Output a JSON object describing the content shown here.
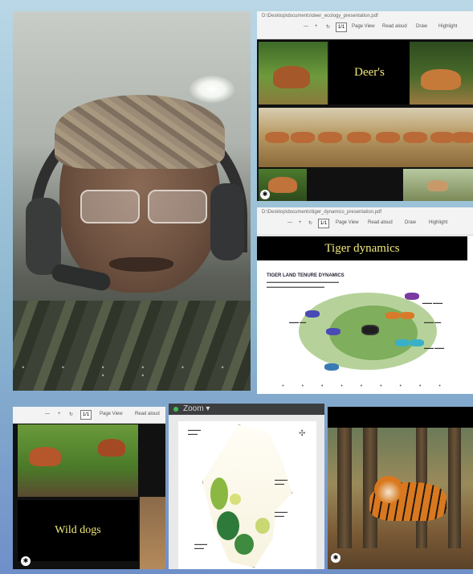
{
  "tiles": {
    "presenter": {
      "type": "video-feed"
    },
    "deer_slide": {
      "title": "Deer's",
      "path_text": "D:\\Desktop\\documents\\deer_ecology_presentation.pdf",
      "toolbar": {
        "page_count": "1/1",
        "page_view": "Page View",
        "read_aloud": "Read aloud",
        "draw": "Draw",
        "highlight": "Highlight"
      }
    },
    "tiger_slide": {
      "title": "Tiger dynamics",
      "path_text": "D:\\Desktop\\documents\\tiger_dynamics_presentation.pdf",
      "toolbar": {
        "page_count": "1/1",
        "page_view": "Page View",
        "read_aloud": "Read aloud",
        "draw": "Draw",
        "highlight": "Highlight"
      },
      "diagram_heading": "TIGER LAND TENURE DYNAMICS"
    },
    "wild_dogs_slide": {
      "title": "Wild dogs",
      "toolbar": {
        "page_count": "1/1",
        "page_view": "Page View",
        "read_aloud": "Read aloud"
      }
    },
    "zoom_window": {
      "app_label": "Zoom"
    },
    "tiger_photo": {}
  },
  "colors": {
    "slide_title": "#f1ea7a",
    "zoom_status": "#3bbd56",
    "background": "#8cb6cf"
  }
}
